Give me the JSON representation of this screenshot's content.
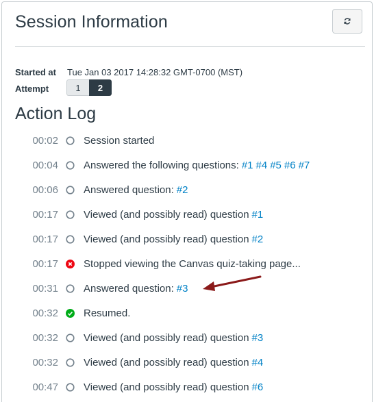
{
  "header": {
    "title": "Session Information",
    "refresh_icon": "refresh-icon"
  },
  "meta": {
    "started_label": "Started at",
    "started_value": "Tue Jan 03 2017 14:28:32 GMT-0700 (MST)",
    "attempt_label": "Attempt",
    "attempts": [
      "1",
      "2"
    ],
    "selected_attempt": "2"
  },
  "action_log": {
    "title": "Action Log",
    "entries": [
      {
        "time": "00:02",
        "status": "neutral",
        "text": "Session started",
        "links": []
      },
      {
        "time": "00:04",
        "status": "neutral",
        "text": "Answered the following questions:",
        "links": [
          "#1",
          "#4",
          "#5",
          "#6",
          "#7"
        ]
      },
      {
        "time": "00:06",
        "status": "neutral",
        "text": "Answered question:",
        "links": [
          "#2"
        ]
      },
      {
        "time": "00:17",
        "status": "neutral",
        "text": "Viewed (and possibly read) question",
        "links": [
          "#1"
        ]
      },
      {
        "time": "00:17",
        "status": "neutral",
        "text": "Viewed (and possibly read) question",
        "links": [
          "#2"
        ]
      },
      {
        "time": "00:17",
        "status": "error",
        "text": "Stopped viewing the Canvas quiz-taking page...",
        "links": []
      },
      {
        "time": "00:31",
        "status": "neutral",
        "text": "Answered question:",
        "links": [
          "#3"
        ]
      },
      {
        "time": "00:32",
        "status": "success",
        "text": "Resumed.",
        "links": []
      },
      {
        "time": "00:32",
        "status": "neutral",
        "text": "Viewed (and possibly read) question",
        "links": [
          "#3"
        ]
      },
      {
        "time": "00:32",
        "status": "neutral",
        "text": "Viewed (and possibly read) question",
        "links": [
          "#4"
        ]
      },
      {
        "time": "00:47",
        "status": "neutral",
        "text": "Viewed (and possibly read) question",
        "links": [
          "#6"
        ]
      }
    ]
  },
  "colors": {
    "text": "#2d3b45",
    "muted": "#73818c",
    "link": "#0081c6",
    "error": "#ee0612",
    "success": "#00ac18",
    "annotation_arrow": "#8b1a1a"
  }
}
